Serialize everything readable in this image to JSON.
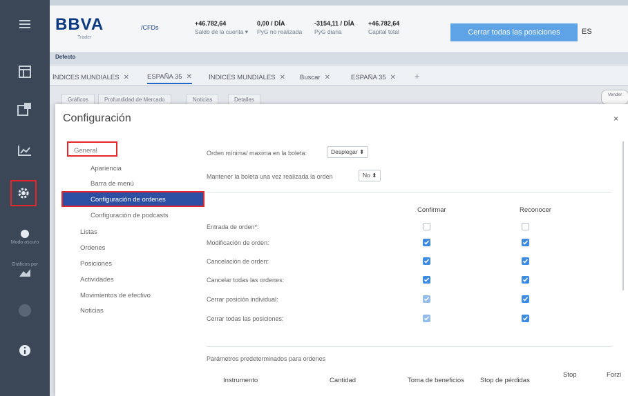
{
  "rail": {
    "dark_mode_label": "Modo oscuro",
    "charts_label": "Gráficos por"
  },
  "header": {
    "logo": "BBVA",
    "logo_sub": "Trader",
    "cfds": "/CFDs",
    "metrics": [
      {
        "value": "+46.782,64",
        "label": "Saldo de la cuenta ▾"
      },
      {
        "value": "0,00 / DÍA",
        "label": "PyG no realizada"
      },
      {
        "value": "-3154,11 / DÍA",
        "label": "PyG diaria"
      },
      {
        "value": "+46.782,64",
        "label": "Capital total"
      }
    ],
    "close_all_label": "Cerrar todas las posiciones",
    "lang": "ES"
  },
  "workspace": {
    "default_label": "Defecto",
    "tabs": [
      {
        "label": "ÍNDICES MUNDIALES"
      },
      {
        "label": "ESPAÑA 35"
      },
      {
        "label": "ÍNDICES MUNDIALES"
      },
      {
        "label": "Buscar"
      },
      {
        "label": "ESPAÑA 35"
      }
    ],
    "subtabs": [
      "Gráficos",
      "Profundidad de Mercado",
      "Noticias",
      "Detalles"
    ],
    "sell_label": "Vender"
  },
  "modal": {
    "title": "Configuración",
    "close": "×",
    "nav": {
      "general": "General",
      "apariencia": "Apariencia",
      "barra_menu": "Barra de menú",
      "config_ordenes": "Configuración de ordenes",
      "config_podcasts": "Configuración de podcasts",
      "listas": "Listas",
      "ordenes": "Ordenes",
      "posiciones": "Posiciones",
      "actividades": "Actividades",
      "movimientos": "Movimientos de efectivo",
      "noticias": "Noticias"
    },
    "order_min_max_label": "Orden mínima/ maxima en la boleta:",
    "order_min_max_value": "Desplegar ⬍",
    "keep_ticket_label": "Mantener la boleta una vez realizada la orden",
    "keep_ticket_value": "No ⬍",
    "col_confirm": "Confirmar",
    "col_ack": "Reconocer",
    "rows": [
      {
        "label": "Entrada de orden*:",
        "confirm": "off",
        "ack": "off"
      },
      {
        "label": "Modificación de orden:",
        "confirm": "on",
        "ack": "on"
      },
      {
        "label": "Cancelación de orden:",
        "confirm": "on",
        "ack": "on"
      },
      {
        "label": "Cancelar todas las ordenes:",
        "confirm": "on",
        "ack": "on"
      },
      {
        "label": "Cerrar posición individual:",
        "confirm": "dim",
        "ack": "on"
      },
      {
        "label": "Cerrar todas las posiciones:",
        "confirm": "dim",
        "ack": "on"
      }
    ],
    "defaults_label": "Parámetros predeterminados para ordenes",
    "table_headers": {
      "instrumento": "Instrumento",
      "cantidad": "Cantidad",
      "toma": "Toma de beneficios",
      "stop_perdidas": "Stop de pérdidas",
      "stop": "Stop",
      "forz": "Forzi"
    }
  }
}
